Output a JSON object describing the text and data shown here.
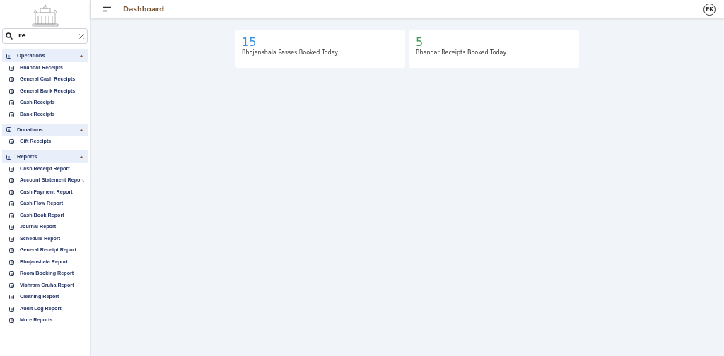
{
  "header": {
    "title": "Dashboard",
    "avatar": "PK"
  },
  "search": {
    "value": "re"
  },
  "sections": [
    {
      "label": "Operations",
      "expanded": true,
      "items": [
        "Bhandar Receipts",
        "General Cash Receipts",
        "General Bank Receipts",
        "Cash Receipts",
        "Bank Receipts"
      ]
    },
    {
      "label": "Donations",
      "expanded": true,
      "items": [
        "Gift Receipts"
      ]
    },
    {
      "label": "Reports",
      "expanded": true,
      "items": [
        "Cash Receipt Report",
        "Account Statement Report",
        "Cash Payment Report",
        "Cash Flow Report",
        "Cash Book Report",
        "Journal Report",
        "Schedule Report",
        "General Receipt Report",
        "Bhojanshala Report",
        "Room Booking Report",
        "Vishram Gruha Report",
        "Cleaning Report",
        "Audit Log Report",
        "More Reports"
      ]
    }
  ],
  "stats": [
    {
      "value": "15",
      "label": "Bhojanshala Passes Booked Today",
      "color": "#3b8fe0"
    },
    {
      "value": "5",
      "label": "Bhandar Receipts Booked Today",
      "color": "#3f9a5a"
    }
  ]
}
